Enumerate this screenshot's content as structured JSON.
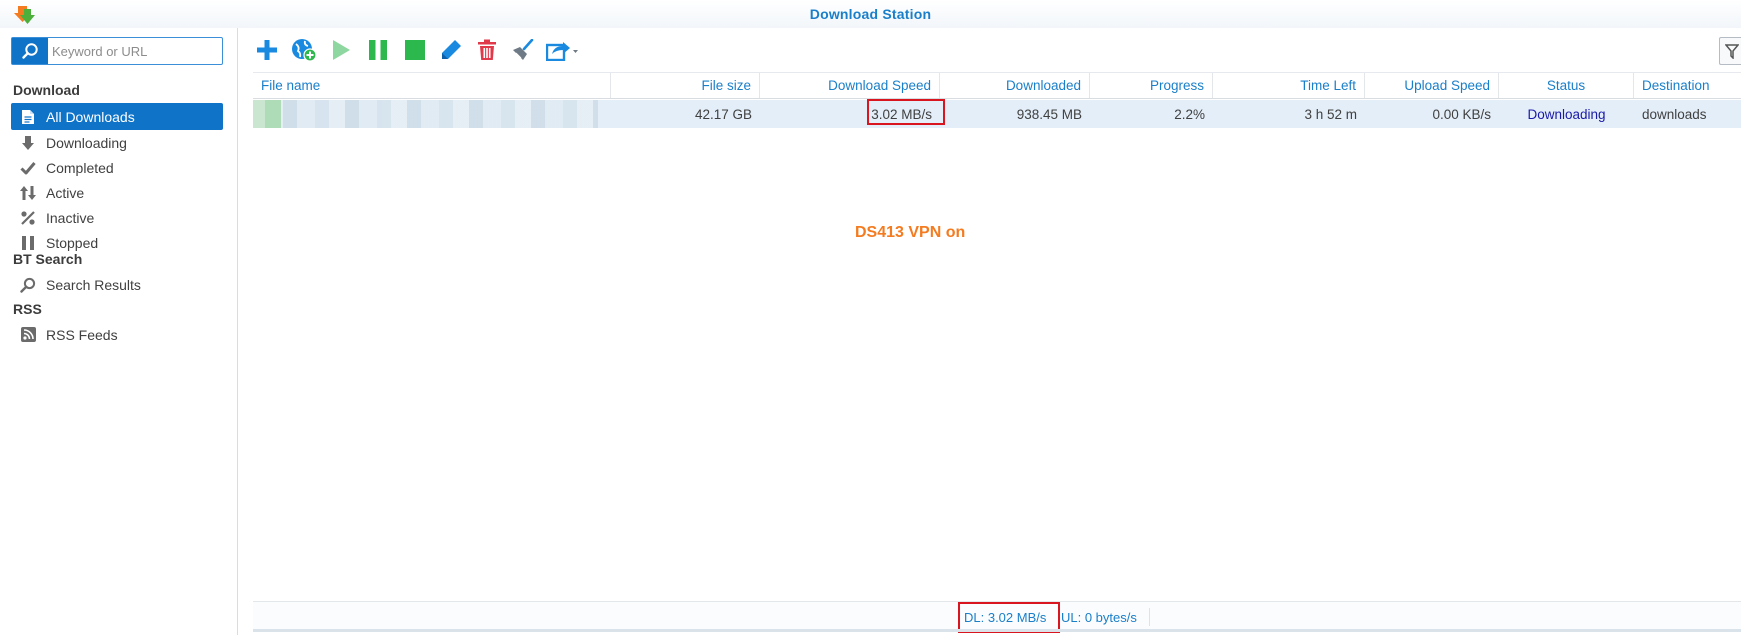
{
  "app": {
    "title": "Download Station"
  },
  "search": {
    "placeholder": "Keyword or URL",
    "value": ""
  },
  "sidebar": {
    "sections": [
      {
        "title": "Download",
        "items": [
          {
            "label": "All Downloads",
            "icon": "document-icon",
            "selected": true
          },
          {
            "label": "Downloading",
            "icon": "arrow-down-icon"
          },
          {
            "label": "Completed",
            "icon": "checkmark-icon"
          },
          {
            "label": "Active",
            "icon": "up-down-arrows-icon"
          },
          {
            "label": "Inactive",
            "icon": "percent-icon"
          },
          {
            "label": "Stopped",
            "icon": "pause-bars-icon"
          }
        ]
      },
      {
        "title": "BT Search",
        "items": [
          {
            "label": "Search Results",
            "icon": "magnifier-icon"
          }
        ]
      },
      {
        "title": "RSS",
        "items": [
          {
            "label": "RSS Feeds",
            "icon": "rss-icon"
          }
        ]
      }
    ]
  },
  "toolbar": {
    "buttons": [
      "add-icon",
      "add-url-globe-icon",
      "resume-icon",
      "pause-icon",
      "stop-icon",
      "edit-icon",
      "delete-icon",
      "clear-completed-icon",
      "share-menu-icon"
    ],
    "colors": {
      "blue": "#1a8ae0",
      "green": "#2db84d",
      "red": "#e0394a",
      "gray": "#6e7a86"
    }
  },
  "grid": {
    "columns": [
      "File name",
      "File size",
      "Download Speed",
      "Downloaded",
      "Progress",
      "Time Left",
      "Upload Speed",
      "Status",
      "Destination"
    ],
    "rows": [
      {
        "file_name": "",
        "file_size": "42.17 GB",
        "download_speed": "3.02 MB/s",
        "downloaded": "938.45 MB",
        "progress": "2.2%",
        "time_left": "3 h 52 m",
        "upload_speed": "0.00 KB/s",
        "status": "Downloading",
        "destination": "downloads"
      }
    ]
  },
  "annotation": "DS413 VPN on",
  "statusbar": {
    "dl": "DL:  3.02 MB/s",
    "ul": "UL:  0 bytes/s"
  },
  "colors": {
    "accent": "#1a7fc9",
    "selected": "#0f73c8",
    "highlight": "#d9151f",
    "annotation": "#f47b20",
    "row": "#e3eef9"
  }
}
